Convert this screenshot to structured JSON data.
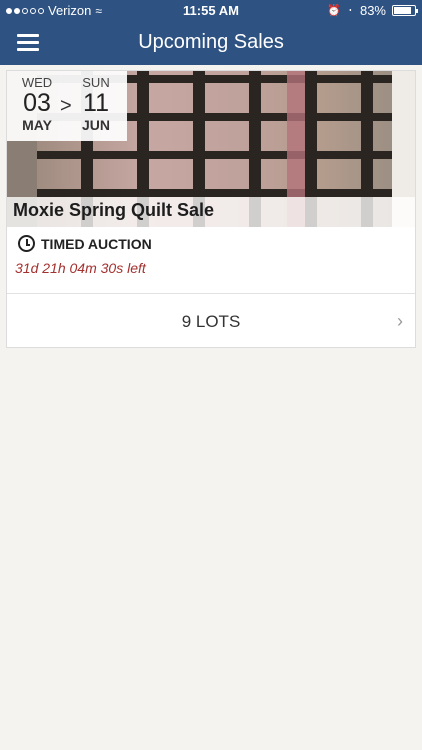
{
  "status_bar": {
    "carrier": "Verizon",
    "time": "11:55 AM",
    "battery": "83%",
    "battery_level": 0.83,
    "signal_bars": 2
  },
  "nav": {
    "title": "Upcoming Sales",
    "menu_icon": "hamburger-menu-icon"
  },
  "sale": {
    "start": {
      "dow": "WED",
      "day": "03",
      "month": "MAY"
    },
    "separator": ">",
    "end": {
      "dow": "SUN",
      "day": "11",
      "month": "JUN"
    },
    "title": "Moxie Spring Quilt Sale",
    "type": "TIMED AUCTION",
    "time_left": "31d 21h 04m 30s left",
    "lots": "9 LOTS"
  },
  "colors": {
    "header": "#2e5282",
    "background": "#f4f3ef",
    "time_left": "#a3312f"
  }
}
